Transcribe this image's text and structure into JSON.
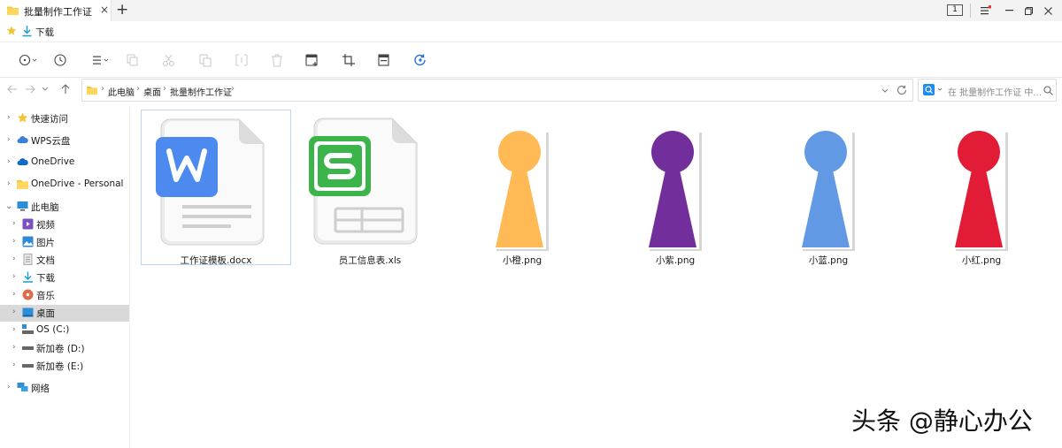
{
  "window": {
    "tab_title": "批量制作工作证",
    "tab_close": "×",
    "new_tab": "+",
    "page_number": "1"
  },
  "favorites": {
    "items": [
      {
        "label": "下载",
        "icon": "download-icon"
      }
    ]
  },
  "address": {
    "crumbs": [
      "此电脑",
      "桌面",
      "批量制作工作证"
    ],
    "search_placeholder": "在 批量制作工作证 中..."
  },
  "sidebar": {
    "items": [
      {
        "label": "快速访问",
        "icon": "star-icon"
      },
      {
        "label": "WPS云盘",
        "icon": "cloud-icon"
      },
      {
        "label": "OneDrive",
        "icon": "cloud-icon"
      },
      {
        "label": "OneDrive - Personal",
        "icon": "folder-icon"
      },
      {
        "label": "此电脑",
        "icon": "computer-icon"
      },
      {
        "label": "视频",
        "icon": "video-icon"
      },
      {
        "label": "图片",
        "icon": "picture-icon"
      },
      {
        "label": "文档",
        "icon": "document-icon"
      },
      {
        "label": "下载",
        "icon": "download-icon"
      },
      {
        "label": "音乐",
        "icon": "music-icon"
      },
      {
        "label": "桌面",
        "icon": "desktop-icon",
        "selected": true
      },
      {
        "label": "OS (C:)",
        "icon": "drive-os-icon"
      },
      {
        "label": "新加卷 (D:)",
        "icon": "drive-icon"
      },
      {
        "label": "新加卷 (E:)",
        "icon": "drive-icon"
      },
      {
        "label": "网络",
        "icon": "network-icon"
      }
    ]
  },
  "files": [
    {
      "name": "工作证模板.docx",
      "icon": "wps-writer-icon",
      "selected": true
    },
    {
      "name": "员工信息表.xls",
      "icon": "wps-spreadsheet-icon"
    },
    {
      "name": "小橙.png",
      "icon": "pawn-image-icon",
      "color": "#FFBA55"
    },
    {
      "name": "小紫.png",
      "icon": "pawn-image-icon",
      "color": "#722F9B"
    },
    {
      "name": "小蓝.png",
      "icon": "pawn-image-icon",
      "color": "#6199E4"
    },
    {
      "name": "小红.png",
      "icon": "pawn-image-icon",
      "color": "#E21C36"
    }
  ],
  "watermark": "头条 @静心办公",
  "colors": {
    "accent": "#1f8bf0",
    "selection": "#d9d9d9",
    "wps_blue": "#4D8AF0",
    "wps_green": "#3BB54A"
  }
}
